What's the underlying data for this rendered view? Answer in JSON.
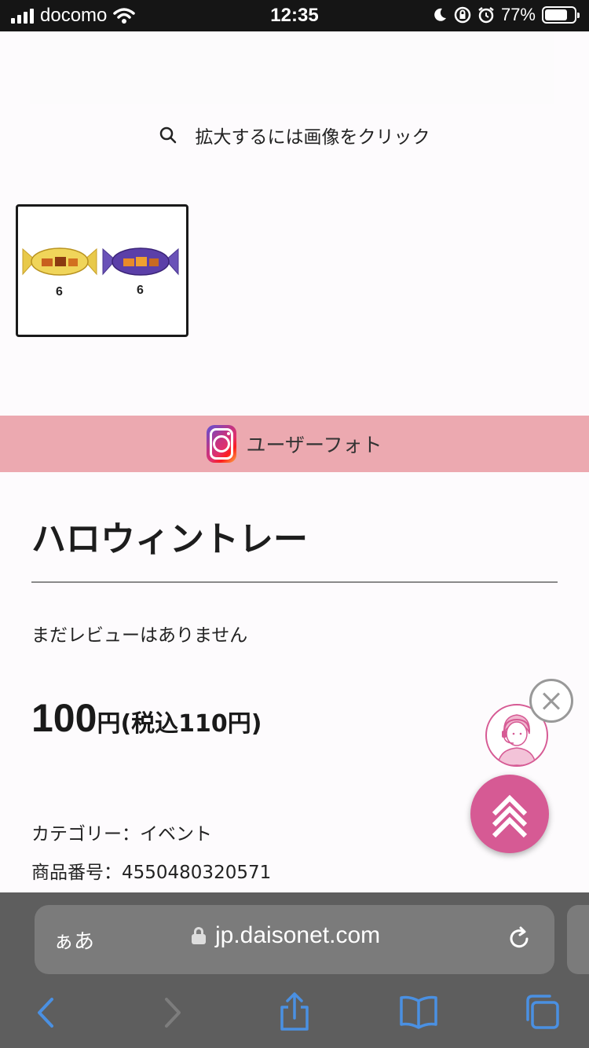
{
  "status_bar": {
    "carrier": "docomo",
    "time": "12:35",
    "battery_percent": "77%",
    "battery_level": 0.77
  },
  "product": {
    "zoom_hint": "拡大するには画像をクリック",
    "thumbnail_labels": [
      "6",
      "6"
    ],
    "user_photo_label": "ユーザーフォト",
    "title": "ハロウィントレー",
    "review_text": "まだレビューはありません",
    "price_main": "100",
    "price_yen": "円",
    "price_tax": "(税込110円)",
    "category_line": "カテゴリー：イベント",
    "item_number_line": "商品番号：4550480320571"
  },
  "browser": {
    "aa_label": "ぁあ",
    "url": "jp.daisonet.com"
  },
  "colors": {
    "insta_bar": "#eca9b0",
    "accent_pink": "#d65a94",
    "browser_bar": "#5e5e5e",
    "toolbar_blue": "#4a90e2"
  },
  "icons": {
    "zoom": "search-icon",
    "user_photo": "instagram-icon",
    "close": "close-icon",
    "support": "support-agent-icon",
    "scroll_top": "double-chevron-up-icon",
    "back": "back-chevron-icon",
    "forward": "forward-chevron-icon",
    "share": "share-icon",
    "bookmarks": "book-icon",
    "tabs": "tabs-icon",
    "reload": "reload-icon",
    "lock": "lock-icon"
  }
}
